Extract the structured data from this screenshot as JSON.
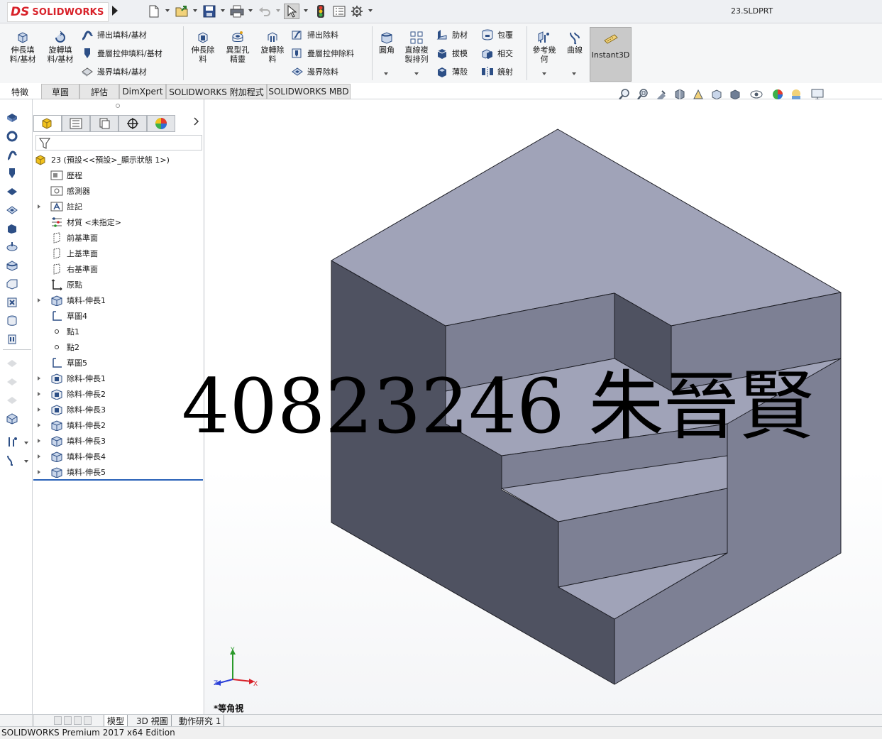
{
  "titlebar": {
    "logo_ds": "DS",
    "logo_text": "SOLIDWORKS",
    "document_title": "23.SLDPRT"
  },
  "command_manager": {
    "features": {
      "extruded_boss": "伸長填\n料/基材",
      "revolved_boss": "旋轉填\n料/基材",
      "swept_boss": "掃出填料/基材",
      "lofted_boss": "疊層拉伸填料/基材",
      "boundary_boss": "邊界填料/基材",
      "extruded_cut": "伸長除\n料",
      "hole_wizard": "異型孔\n精靈",
      "revolved_cut": "旋轉除\n料",
      "swept_cut": "掃出除料",
      "lofted_cut": "疊層拉伸除料",
      "boundary_cut": "邊界除料",
      "fillet": "圓角",
      "linear_pattern": "直線複\n製排列",
      "rib": "肋材",
      "draft": "拔模",
      "shell": "薄殼",
      "wrap": "包覆",
      "intersect": "相交",
      "mirror": "鏡射",
      "reference_geometry": "參考幾\n何",
      "curves": "曲線",
      "instant3d": "Instant3D"
    },
    "tabs": [
      "特徵",
      "草圖",
      "評估",
      "DimXpert",
      "SOLIDWORKS 附加程式",
      "SOLIDWORKS MBD"
    ]
  },
  "feature_manager": {
    "root": "23  (預設<<預設>_顯示狀態 1>)",
    "items": [
      {
        "label": "歷程",
        "icon": "history-folder-icon",
        "expandable": false
      },
      {
        "label": "感測器",
        "icon": "sensors-folder-icon",
        "expandable": false
      },
      {
        "label": "註記",
        "icon": "annotations-folder-icon",
        "expandable": true
      },
      {
        "label": "材質 <未指定>",
        "icon": "material-icon",
        "expandable": false
      },
      {
        "label": "前基準面",
        "icon": "plane-icon",
        "expandable": false
      },
      {
        "label": "上基準面",
        "icon": "plane-icon",
        "expandable": false
      },
      {
        "label": "右基準面",
        "icon": "plane-icon",
        "expandable": false
      },
      {
        "label": "原點",
        "icon": "origin-icon",
        "expandable": false
      },
      {
        "label": "填料-伸長1",
        "icon": "extrude-boss-icon",
        "expandable": true
      },
      {
        "label": "草圖4",
        "icon": "sketch-icon",
        "expandable": false
      },
      {
        "label": "點1",
        "icon": "point-icon",
        "expandable": false
      },
      {
        "label": "點2",
        "icon": "point-icon",
        "expandable": false
      },
      {
        "label": "草圖5",
        "icon": "sketch-icon",
        "expandable": false
      },
      {
        "label": "除料-伸長1",
        "icon": "extrude-cut-icon",
        "expandable": true
      },
      {
        "label": "除料-伸長2",
        "icon": "extrude-cut-icon",
        "expandable": true
      },
      {
        "label": "除料-伸長3",
        "icon": "extrude-cut-icon",
        "expandable": true
      },
      {
        "label": "填料-伸長2",
        "icon": "extrude-boss-icon",
        "expandable": true
      },
      {
        "label": "填料-伸長3",
        "icon": "extrude-boss-icon",
        "expandable": true
      },
      {
        "label": "填料-伸長4",
        "icon": "extrude-boss-icon",
        "expandable": true
      },
      {
        "label": "填料-伸長5",
        "icon": "extrude-boss-icon",
        "expandable": true
      }
    ]
  },
  "graphics": {
    "view_name": "*等角視",
    "watermark": "40823246 朱晉賢",
    "triad": {
      "x": "X",
      "y": "Y",
      "z": "Z"
    },
    "model_colors": {
      "top": "#a0a3b8",
      "light": "#7d8094",
      "dark": "#4f5261",
      "edge": "#1c1d24"
    }
  },
  "bottom_tabs": [
    "模型",
    "3D 視圖",
    "動作研究 1"
  ],
  "status": "SOLIDWORKS Premium 2017 x64 Edition"
}
